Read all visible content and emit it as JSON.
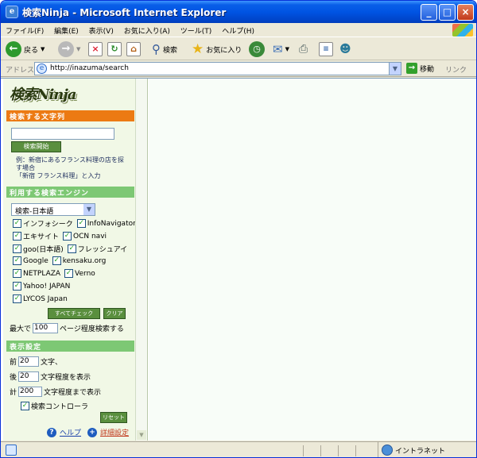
{
  "window": {
    "title": "検索Ninja - Microsoft Internet Explorer",
    "app_icon_glyph": "e",
    "controls": {
      "minimize": "_",
      "maximize": "□",
      "close": "×"
    }
  },
  "menu": [
    "ファイル(F)",
    "編集(E)",
    "表示(V)",
    "お気に入り(A)",
    "ツール(T)",
    "ヘルプ(H)"
  ],
  "toolbar": {
    "back": "戻る",
    "search": "検索",
    "favorites": "お気に入り"
  },
  "address": {
    "label": "アドレス(D)",
    "url": "http://inazuma/search",
    "go": "移動",
    "links": "リンク"
  },
  "sidebar": {
    "logo_text": "検索Ninja",
    "search_section": {
      "header": "検索する文字列",
      "input_value": "",
      "button": "検索開始",
      "hint_line1": "例：新宿にあるフランス料理の店を探",
      "hint_line2": "す場合",
      "hint_line3": "「新宿 フランス料理」と入力"
    },
    "engine_section": {
      "header": "利用する検索エンジン",
      "select_value": "検索-日本語",
      "engines": [
        [
          "インフォシーク",
          "InfoNavigator"
        ],
        [
          "エキサイト",
          "OCN navi"
        ],
        [
          "goo(日本語)",
          "フレッシュアイ"
        ],
        [
          "Google",
          "kensaku.org"
        ],
        [
          "NETPLAZA",
          "Verno"
        ],
        [
          "Yahoo! JAPAN"
        ],
        [
          "LYCOS Japan"
        ]
      ],
      "check_all": "すべてチェック",
      "clear": "クリア",
      "max_prefix": "最大で",
      "max_value": "100",
      "max_suffix": "ページ程度検索する"
    },
    "display_section": {
      "header": "表示設定",
      "before_label": "前",
      "before_value": "20",
      "before_suffix": "文字、",
      "after_label": "後",
      "after_value": "20",
      "after_suffix": "文字程度を表示",
      "total_label": "計",
      "total_value": "200",
      "total_suffix": "文字程度まで表示",
      "controller_label": "検索コントローラ",
      "reset": "リセット"
    },
    "footer": {
      "help": "ヘルプ",
      "advanced": "詳細設定"
    }
  },
  "status": {
    "zone": "イントラネット"
  },
  "colors": {
    "titlebar": "#0054e3",
    "section_orange": "#ec7a13",
    "section_green": "#7dc874",
    "button_green": "#5a8f3e",
    "sidebar_bg": "#f1f8e6"
  }
}
